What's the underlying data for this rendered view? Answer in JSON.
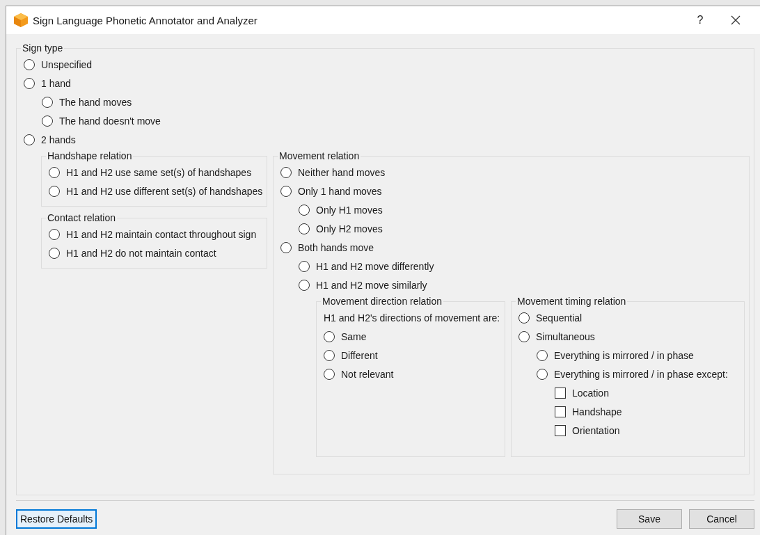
{
  "window": {
    "title": "Sign Language Phonetic Annotator and Analyzer",
    "help": "?"
  },
  "sign_type": {
    "title": "Sign type",
    "options": [
      {
        "kind": "radio",
        "label": "Unspecified",
        "selected": false
      },
      {
        "kind": "radio",
        "label": "1 hand",
        "selected": false,
        "children": [
          {
            "kind": "radio",
            "label": "The hand moves",
            "selected": false
          },
          {
            "kind": "radio",
            "label": "The hand doesn't move",
            "selected": false
          }
        ]
      },
      {
        "kind": "radio",
        "label": "2 hands",
        "selected": false,
        "columns": [
          [
            {
              "title": "Handshape relation",
              "children": [
                {
                  "kind": "radio",
                  "label": "H1 and H2 use same set(s) of handshapes",
                  "selected": false
                },
                {
                  "kind": "radio",
                  "label": "H1 and H2 use different set(s) of handshapes",
                  "selected": false
                }
              ]
            },
            {
              "title": "Contact relation",
              "children": [
                {
                  "kind": "radio",
                  "label": "H1 and H2 maintain contact throughout sign",
                  "selected": false
                },
                {
                  "kind": "radio",
                  "label": "H1 and H2 do not maintain contact",
                  "selected": false
                }
              ]
            }
          ],
          [
            {
              "title": "Movement relation",
              "children": [
                {
                  "kind": "radio",
                  "label": "Neither hand moves",
                  "selected": false
                },
                {
                  "kind": "radio",
                  "label": "Only 1 hand moves",
                  "selected": false,
                  "children": [
                    {
                      "kind": "radio",
                      "label": "Only H1 moves",
                      "selected": false
                    },
                    {
                      "kind": "radio",
                      "label": "Only H2 moves",
                      "selected": false
                    }
                  ]
                },
                {
                  "kind": "radio",
                  "label": "Both hands move",
                  "selected": false,
                  "children": [
                    {
                      "kind": "radio",
                      "label": "H1 and H2 move differently",
                      "selected": false
                    },
                    {
                      "kind": "radio",
                      "label": "H1 and H2 move similarly",
                      "selected": false,
                      "columns": [
                        [
                          {
                            "title": "Movement direction relation",
                            "children": [
                              {
                                "kind": "text",
                                "label": "H1 and H2's directions of movement are:"
                              },
                              {
                                "kind": "radio",
                                "label": "Same",
                                "selected": false
                              },
                              {
                                "kind": "radio",
                                "label": "Different",
                                "selected": false
                              },
                              {
                                "kind": "radio",
                                "label": "Not relevant",
                                "selected": false
                              }
                            ]
                          }
                        ],
                        [
                          {
                            "title": "Movement timing relation",
                            "children": [
                              {
                                "kind": "radio",
                                "label": "Sequential",
                                "selected": false
                              },
                              {
                                "kind": "radio",
                                "label": "Simultaneous",
                                "selected": false,
                                "children": [
                                  {
                                    "kind": "radio",
                                    "label": "Everything is mirrored / in phase",
                                    "selected": false
                                  },
                                  {
                                    "kind": "radio",
                                    "label": "Everything is mirrored / in phase except:",
                                    "selected": false,
                                    "children": [
                                      {
                                        "kind": "checkbox",
                                        "label": "Location",
                                        "checked": false
                                      },
                                      {
                                        "kind": "checkbox",
                                        "label": "Handshape",
                                        "checked": false
                                      },
                                      {
                                        "kind": "checkbox",
                                        "label": "Orientation",
                                        "checked": false
                                      }
                                    ]
                                  }
                                ]
                              }
                            ]
                          }
                        ]
                      ]
                    }
                  ]
                }
              ]
            }
          ]
        ]
      }
    ]
  },
  "left_buttons": [
    {
      "label": "Restore Defaults",
      "focused": true
    }
  ],
  "right_buttons": [
    {
      "label": "Save",
      "focused": false
    },
    {
      "label": "Cancel",
      "focused": false
    }
  ]
}
